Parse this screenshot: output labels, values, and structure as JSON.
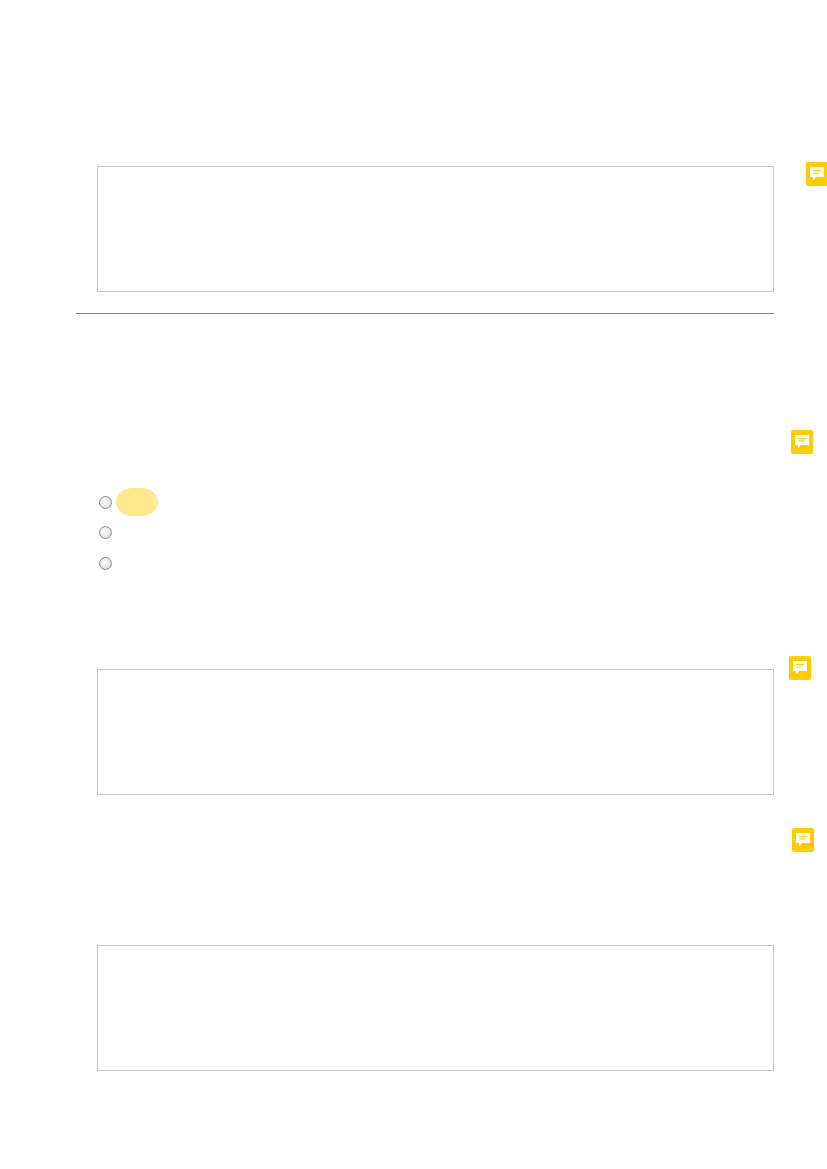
{
  "blocks": [
    {
      "kind": "textarea",
      "has_comment": true
    },
    {
      "kind": "rule",
      "has_comment": false
    },
    {
      "kind": "radios",
      "has_comment": true,
      "options": [
        {
          "selected": false,
          "highlighted": true
        },
        {
          "selected": false,
          "highlighted": false
        },
        {
          "selected": false,
          "highlighted": false
        }
      ]
    },
    {
      "kind": "textarea",
      "has_comment": true
    },
    {
      "kind": "textarea",
      "has_comment": true
    }
  ]
}
